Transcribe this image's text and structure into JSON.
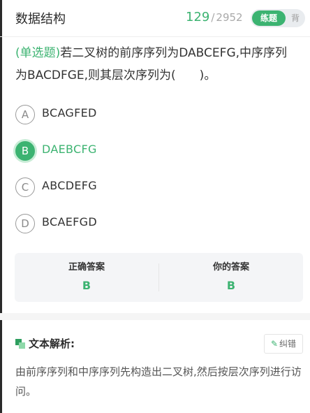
{
  "header": {
    "title": "数据结构",
    "progress_current": "129",
    "progress_separator": "/",
    "progress_total": "2952",
    "mode_practice": "练题",
    "mode_recite": "背"
  },
  "question": {
    "type_label": "(单选题)",
    "text": "若二叉树的前序序列为DABCEFG,中序序列为BACDFGE,则其层次序列为(　　)。"
  },
  "options": [
    {
      "letter": "A",
      "text": "BCAGFED",
      "selected": false
    },
    {
      "letter": "B",
      "text": "DAEBCFG",
      "selected": true
    },
    {
      "letter": "C",
      "text": "ABCDEFG",
      "selected": false
    },
    {
      "letter": "D",
      "text": "BCAEFGD",
      "selected": false
    }
  ],
  "answers": {
    "correct_label": "正确答案",
    "correct_value": "B",
    "yours_label": "你的答案",
    "yours_value": "B"
  },
  "analysis": {
    "icon": "analysis-section-icon",
    "title": "文本解析:",
    "report_icon": "edit-pen-icon",
    "report_label": "纠错",
    "body": "由前序序列和中序序列先构造出二叉树,然后按层次序列进行访问。"
  },
  "colors": {
    "accent": "#3cb371",
    "accent_light": "#c8ecd6",
    "text": "#333333",
    "muted": "#a9a9a9",
    "panel": "#f4f5f7"
  }
}
